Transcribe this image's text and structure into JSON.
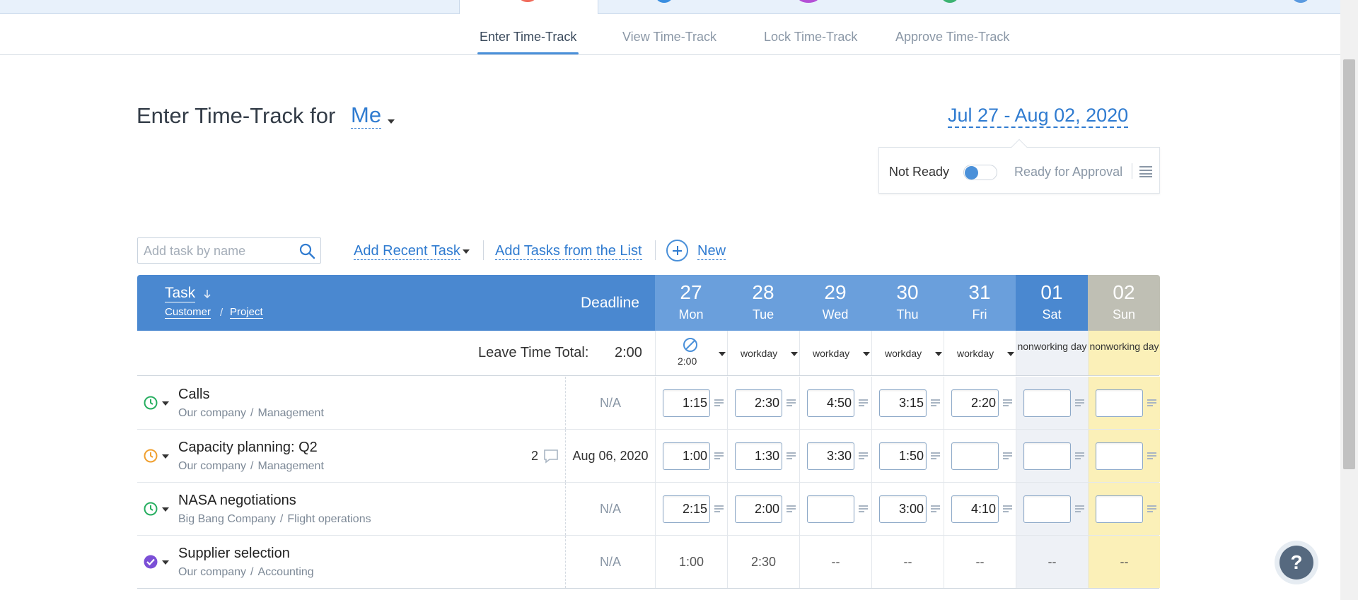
{
  "subnav": {
    "tabs": [
      "Enter Time-Track",
      "View Time-Track",
      "Lock Time-Track",
      "Approve Time-Track"
    ]
  },
  "heading": {
    "title": "Enter Time-Track for",
    "user": "Me",
    "date_range": "Jul 27 - Aug 02, 2020"
  },
  "status": {
    "not_ready": "Not Ready",
    "ready": "Ready for Approval",
    "toggle_on": false
  },
  "toolbar": {
    "search_placeholder": "Add task by name",
    "add_recent": "Add Recent Task",
    "add_from_list": "Add Tasks from the List",
    "new": "New"
  },
  "table": {
    "header": {
      "task": "Task",
      "customer": "Customer",
      "separator": "/",
      "project": "Project",
      "deadline": "Deadline"
    },
    "days": [
      {
        "num": "27",
        "dow": "Mon"
      },
      {
        "num": "28",
        "dow": "Tue"
      },
      {
        "num": "29",
        "dow": "Wed"
      },
      {
        "num": "30",
        "dow": "Thu"
      },
      {
        "num": "31",
        "dow": "Fri"
      },
      {
        "num": "01",
        "dow": "Sat"
      },
      {
        "num": "02",
        "dow": "Sun"
      }
    ],
    "day_colors": {
      "weekday": "#6a9fdc",
      "saturday": "#4a88d0",
      "sunday": "#bfbfb4"
    },
    "leave": {
      "label": "Leave Time Total:",
      "total": "2:00",
      "mon_value": "2:00",
      "cells": [
        "",
        "workday",
        "workday",
        "workday",
        "workday",
        "nonworking day",
        "nonworking day"
      ]
    },
    "rows": [
      {
        "name": "Calls",
        "customer": "Our company",
        "project": "Management",
        "deadline": "N/A",
        "icon": "clock-icon",
        "icon_color": "#27ae60",
        "comments": "",
        "cells": [
          "1:15",
          "2:30",
          "4:50",
          "3:15",
          "2:20",
          "",
          ""
        ]
      },
      {
        "name": "Capacity planning: Q2",
        "customer": "Our company",
        "project": "Management",
        "deadline": "Aug 06, 2020",
        "icon": "clock-icon",
        "icon_color": "#f0a030",
        "comments": "2",
        "cells": [
          "1:00",
          "1:30",
          "3:30",
          "1:50",
          "",
          "",
          ""
        ]
      },
      {
        "name": "NASA negotiations",
        "customer": "Big Bang Company",
        "project": "Flight operations",
        "deadline": "N/A",
        "icon": "clock-icon",
        "icon_color": "#27ae60",
        "comments": "",
        "cells": [
          "2:15",
          "2:00",
          "",
          "3:00",
          "4:10",
          "",
          ""
        ]
      },
      {
        "name": "Supplier selection",
        "customer": "Our company",
        "project": "Accounting",
        "deadline": "N/A",
        "icon": "check-circle-icon",
        "icon_color": "#7b4fd6",
        "comments": "",
        "cells": [
          "1:00",
          "2:30",
          "--",
          "--",
          "--",
          "--",
          "--"
        ]
      }
    ]
  },
  "help": {
    "label": "?"
  }
}
